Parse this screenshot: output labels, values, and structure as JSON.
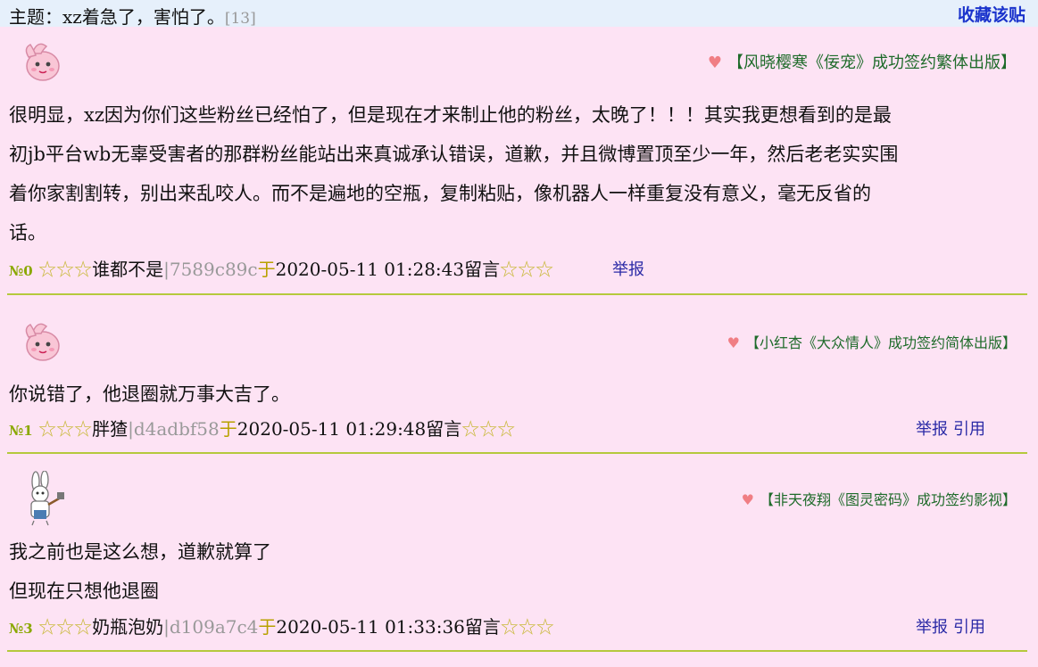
{
  "header": {
    "topic_prefix": "主题：",
    "topic_title": "xz着急了，害怕了。",
    "reply_count": "[13]",
    "favorite_label": "收藏该贴"
  },
  "posts": [
    {
      "ad": "【风晓樱寒《佞宠》成功签约繁体出版】",
      "lines": [
        "很明显，xz因为你们这些粉丝已经怕了，但是现在才来制止他的粉丝，太晚了！！！其实我更想看到的是最",
        "初jb平台wb无辜受害者的那群粉丝能站出来真诚承认错误，道歉，并且微博置顶至少一年，然后老老实实围",
        "着你家割割转，别出来乱咬人。而不是遍地的空瓶，复制粘贴，像机器人一样重复没有意义，毫无反省的",
        "话。"
      ],
      "number": "№0",
      "stars_before": "☆☆☆",
      "author": "谁都不是",
      "hash": "|7589c89c",
      "yu": "于",
      "datetime": "2020-05-11 01:28:43",
      "liuyan": "留言",
      "stars_after": "☆☆☆",
      "report": "举报",
      "quote": ""
    },
    {
      "ad": "【小红杏《大众情人》成功签约简体出版】",
      "lines": [
        "你说错了，他退圈就万事大吉了。"
      ],
      "number": "№1",
      "stars_before": "☆☆☆",
      "author": "胖猹",
      "hash": "|d4adbf58",
      "yu": "于",
      "datetime": "2020-05-11 01:29:48",
      "liuyan": "留言",
      "stars_after": "☆☆☆",
      "report": "举报",
      "quote": "引用"
    },
    {
      "ad": "【非天夜翔《图灵密码》成功签约影视】",
      "lines": [
        "我之前也是这么想，道歉就算了",
        "但现在只想他退圈"
      ],
      "number": "№3",
      "stars_before": "☆☆☆",
      "author": "奶瓶泡奶",
      "hash": "|d109a7c4",
      "yu": "于",
      "datetime": "2020-05-11 01:33:36",
      "liuyan": "留言",
      "stars_after": "☆☆☆",
      "report": "举报",
      "quote": "引用"
    }
  ]
}
